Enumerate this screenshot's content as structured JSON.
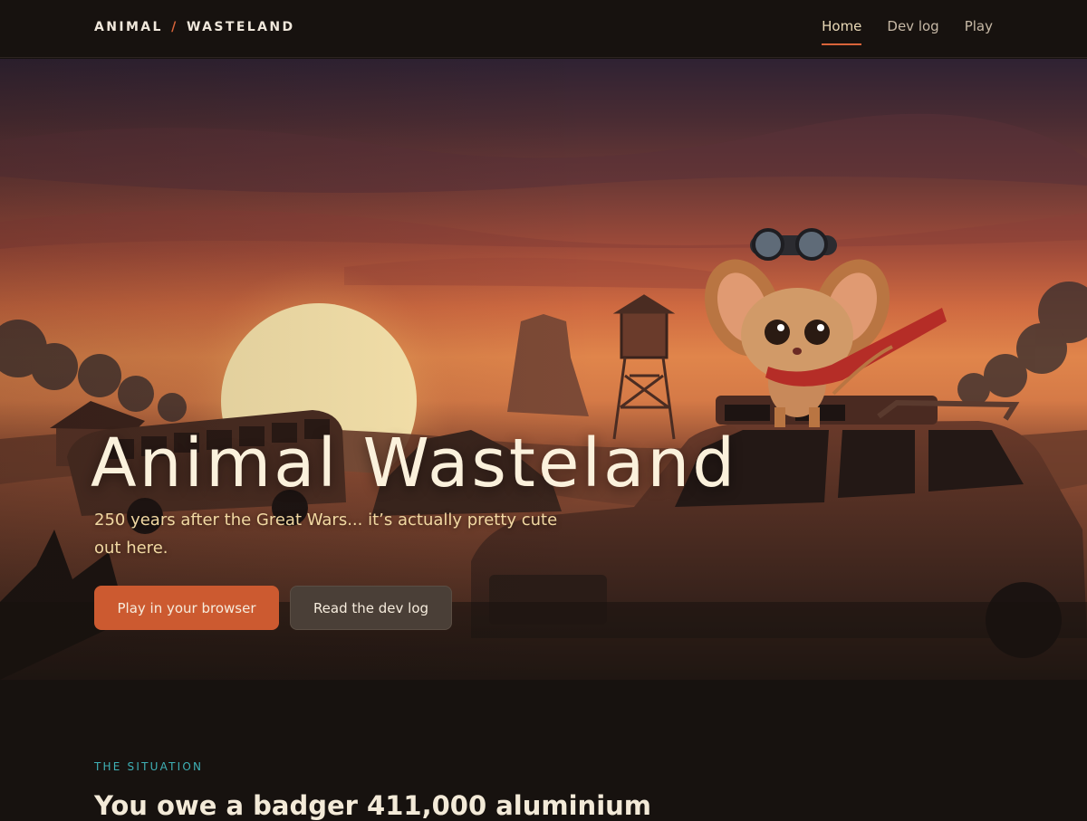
{
  "brand": {
    "left": "ANIMAL",
    "separator": "/",
    "right": "WASTELAND"
  },
  "nav": {
    "items": [
      {
        "label": "Home",
        "active": true
      },
      {
        "label": "Dev log",
        "active": false
      },
      {
        "label": "Play",
        "active": false
      }
    ]
  },
  "hero": {
    "title": "Animal Wasteland",
    "subtitle": "250 years after the Great Wars... it’s actually pretty cute out here.",
    "primary_button": "Play in your browser",
    "secondary_button": "Read the dev log",
    "image_subject": "mouse-with-goggles-on-rusted-car-wasteland-sunset"
  },
  "situation": {
    "eyebrow": "THE SITUATION",
    "heading": "You owe a badger 411,000 aluminium"
  },
  "colors": {
    "accent": "#cc5a30",
    "nav_active_underline": "#d9643a",
    "eyebrow": "#3fb1b6",
    "background": "#17120f"
  }
}
